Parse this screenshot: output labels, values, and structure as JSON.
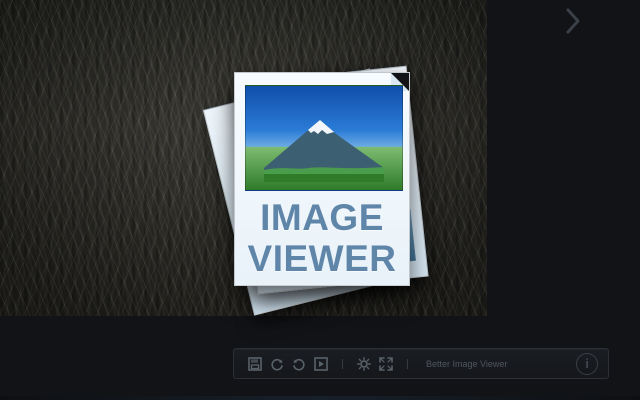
{
  "viewer": {
    "icon_title_line1": "IMAGE",
    "icon_title_line2": "VIEWER"
  },
  "toolbar": {
    "app_name": "Better Image Viewer",
    "icons": [
      "save-icon",
      "rotate-right-icon",
      "rotate-left-icon",
      "slideshow-icon",
      "gear-icon",
      "fullscreen-icon",
      "info-icon"
    ]
  },
  "colors": {
    "background": "#111316",
    "toolbar_border": "#2b2f36",
    "accent_text": "#5f86a9"
  }
}
